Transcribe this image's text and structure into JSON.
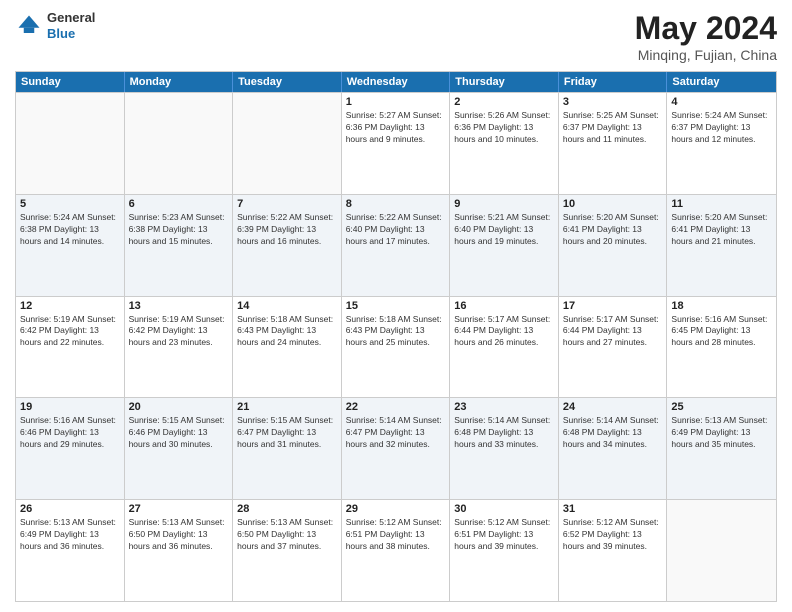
{
  "header": {
    "logo": {
      "general": "General",
      "blue": "Blue"
    },
    "title": "May 2024",
    "subtitle": "Minqing, Fujian, China"
  },
  "calendar": {
    "days_of_week": [
      "Sunday",
      "Monday",
      "Tuesday",
      "Wednesday",
      "Thursday",
      "Friday",
      "Saturday"
    ],
    "weeks": [
      {
        "alt": false,
        "cells": [
          {
            "day": "",
            "info": ""
          },
          {
            "day": "",
            "info": ""
          },
          {
            "day": "",
            "info": ""
          },
          {
            "day": "1",
            "info": "Sunrise: 5:27 AM\nSunset: 6:36 PM\nDaylight: 13 hours and 9 minutes."
          },
          {
            "day": "2",
            "info": "Sunrise: 5:26 AM\nSunset: 6:36 PM\nDaylight: 13 hours and 10 minutes."
          },
          {
            "day": "3",
            "info": "Sunrise: 5:25 AM\nSunset: 6:37 PM\nDaylight: 13 hours and 11 minutes."
          },
          {
            "day": "4",
            "info": "Sunrise: 5:24 AM\nSunset: 6:37 PM\nDaylight: 13 hours and 12 minutes."
          }
        ]
      },
      {
        "alt": true,
        "cells": [
          {
            "day": "5",
            "info": "Sunrise: 5:24 AM\nSunset: 6:38 PM\nDaylight: 13 hours and 14 minutes."
          },
          {
            "day": "6",
            "info": "Sunrise: 5:23 AM\nSunset: 6:38 PM\nDaylight: 13 hours and 15 minutes."
          },
          {
            "day": "7",
            "info": "Sunrise: 5:22 AM\nSunset: 6:39 PM\nDaylight: 13 hours and 16 minutes."
          },
          {
            "day": "8",
            "info": "Sunrise: 5:22 AM\nSunset: 6:40 PM\nDaylight: 13 hours and 17 minutes."
          },
          {
            "day": "9",
            "info": "Sunrise: 5:21 AM\nSunset: 6:40 PM\nDaylight: 13 hours and 19 minutes."
          },
          {
            "day": "10",
            "info": "Sunrise: 5:20 AM\nSunset: 6:41 PM\nDaylight: 13 hours and 20 minutes."
          },
          {
            "day": "11",
            "info": "Sunrise: 5:20 AM\nSunset: 6:41 PM\nDaylight: 13 hours and 21 minutes."
          }
        ]
      },
      {
        "alt": false,
        "cells": [
          {
            "day": "12",
            "info": "Sunrise: 5:19 AM\nSunset: 6:42 PM\nDaylight: 13 hours and 22 minutes."
          },
          {
            "day": "13",
            "info": "Sunrise: 5:19 AM\nSunset: 6:42 PM\nDaylight: 13 hours and 23 minutes."
          },
          {
            "day": "14",
            "info": "Sunrise: 5:18 AM\nSunset: 6:43 PM\nDaylight: 13 hours and 24 minutes."
          },
          {
            "day": "15",
            "info": "Sunrise: 5:18 AM\nSunset: 6:43 PM\nDaylight: 13 hours and 25 minutes."
          },
          {
            "day": "16",
            "info": "Sunrise: 5:17 AM\nSunset: 6:44 PM\nDaylight: 13 hours and 26 minutes."
          },
          {
            "day": "17",
            "info": "Sunrise: 5:17 AM\nSunset: 6:44 PM\nDaylight: 13 hours and 27 minutes."
          },
          {
            "day": "18",
            "info": "Sunrise: 5:16 AM\nSunset: 6:45 PM\nDaylight: 13 hours and 28 minutes."
          }
        ]
      },
      {
        "alt": true,
        "cells": [
          {
            "day": "19",
            "info": "Sunrise: 5:16 AM\nSunset: 6:46 PM\nDaylight: 13 hours and 29 minutes."
          },
          {
            "day": "20",
            "info": "Sunrise: 5:15 AM\nSunset: 6:46 PM\nDaylight: 13 hours and 30 minutes."
          },
          {
            "day": "21",
            "info": "Sunrise: 5:15 AM\nSunset: 6:47 PM\nDaylight: 13 hours and 31 minutes."
          },
          {
            "day": "22",
            "info": "Sunrise: 5:14 AM\nSunset: 6:47 PM\nDaylight: 13 hours and 32 minutes."
          },
          {
            "day": "23",
            "info": "Sunrise: 5:14 AM\nSunset: 6:48 PM\nDaylight: 13 hours and 33 minutes."
          },
          {
            "day": "24",
            "info": "Sunrise: 5:14 AM\nSunset: 6:48 PM\nDaylight: 13 hours and 34 minutes."
          },
          {
            "day": "25",
            "info": "Sunrise: 5:13 AM\nSunset: 6:49 PM\nDaylight: 13 hours and 35 minutes."
          }
        ]
      },
      {
        "alt": false,
        "cells": [
          {
            "day": "26",
            "info": "Sunrise: 5:13 AM\nSunset: 6:49 PM\nDaylight: 13 hours and 36 minutes."
          },
          {
            "day": "27",
            "info": "Sunrise: 5:13 AM\nSunset: 6:50 PM\nDaylight: 13 hours and 36 minutes."
          },
          {
            "day": "28",
            "info": "Sunrise: 5:13 AM\nSunset: 6:50 PM\nDaylight: 13 hours and 37 minutes."
          },
          {
            "day": "29",
            "info": "Sunrise: 5:12 AM\nSunset: 6:51 PM\nDaylight: 13 hours and 38 minutes."
          },
          {
            "day": "30",
            "info": "Sunrise: 5:12 AM\nSunset: 6:51 PM\nDaylight: 13 hours and 39 minutes."
          },
          {
            "day": "31",
            "info": "Sunrise: 5:12 AM\nSunset: 6:52 PM\nDaylight: 13 hours and 39 minutes."
          },
          {
            "day": "",
            "info": ""
          }
        ]
      }
    ]
  }
}
